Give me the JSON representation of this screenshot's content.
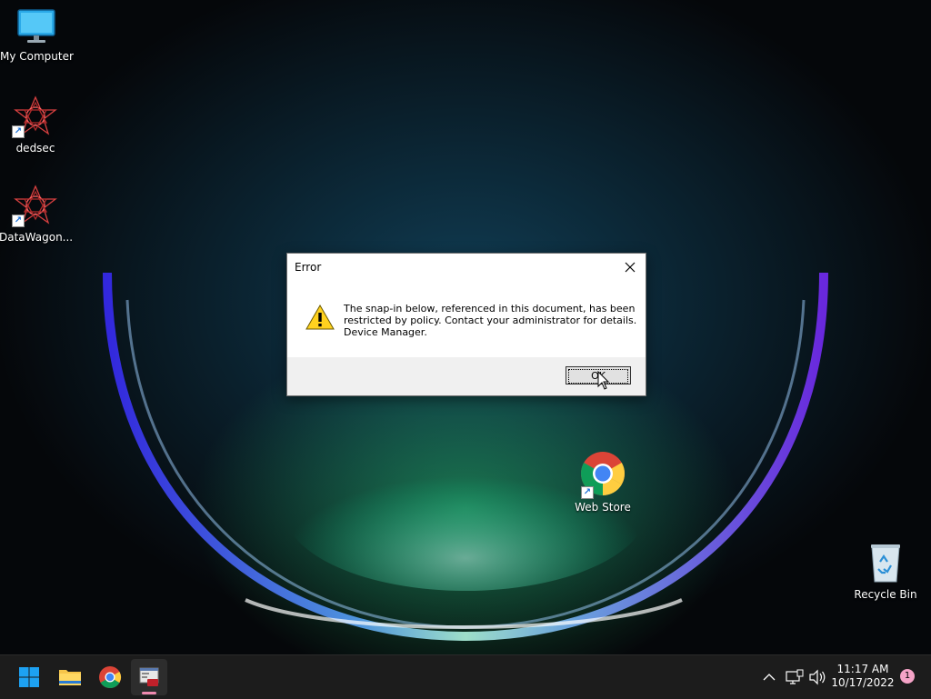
{
  "desktop": {
    "icons": [
      {
        "label": "My Computer",
        "icon": "monitor-icon"
      },
      {
        "label": "dedsec",
        "icon": "dedsec-icon"
      },
      {
        "label": "DataWagon...",
        "icon": "dedsec-icon"
      },
      {
        "label": "Web Store",
        "icon": "chrome-icon"
      },
      {
        "label": "Recycle Bin",
        "icon": "recycle-bin-icon"
      }
    ]
  },
  "dialog": {
    "title": "Error",
    "icon": "warning-icon",
    "message_lines": [
      "The snap-in below, referenced in this document, has been",
      "restricted by policy. Contact your administrator for details.",
      "Device Manager."
    ],
    "ok_label": "OK"
  },
  "taskbar": {
    "items": [
      {
        "name": "start-button",
        "icon": "windows-icon"
      },
      {
        "name": "file-explorer",
        "icon": "folder-icon"
      },
      {
        "name": "chrome",
        "icon": "chrome-icon"
      },
      {
        "name": "mmc-app",
        "icon": "toolbox-icon",
        "active": true
      }
    ],
    "time": "11:17 AM",
    "date": "10/17/2022",
    "notification_count": "1"
  },
  "colors": {
    "accent": "#0078d4",
    "glow_blue": "#3a5bff",
    "glow_green": "#2fd07a",
    "taskbar": "#1c1c1c"
  }
}
